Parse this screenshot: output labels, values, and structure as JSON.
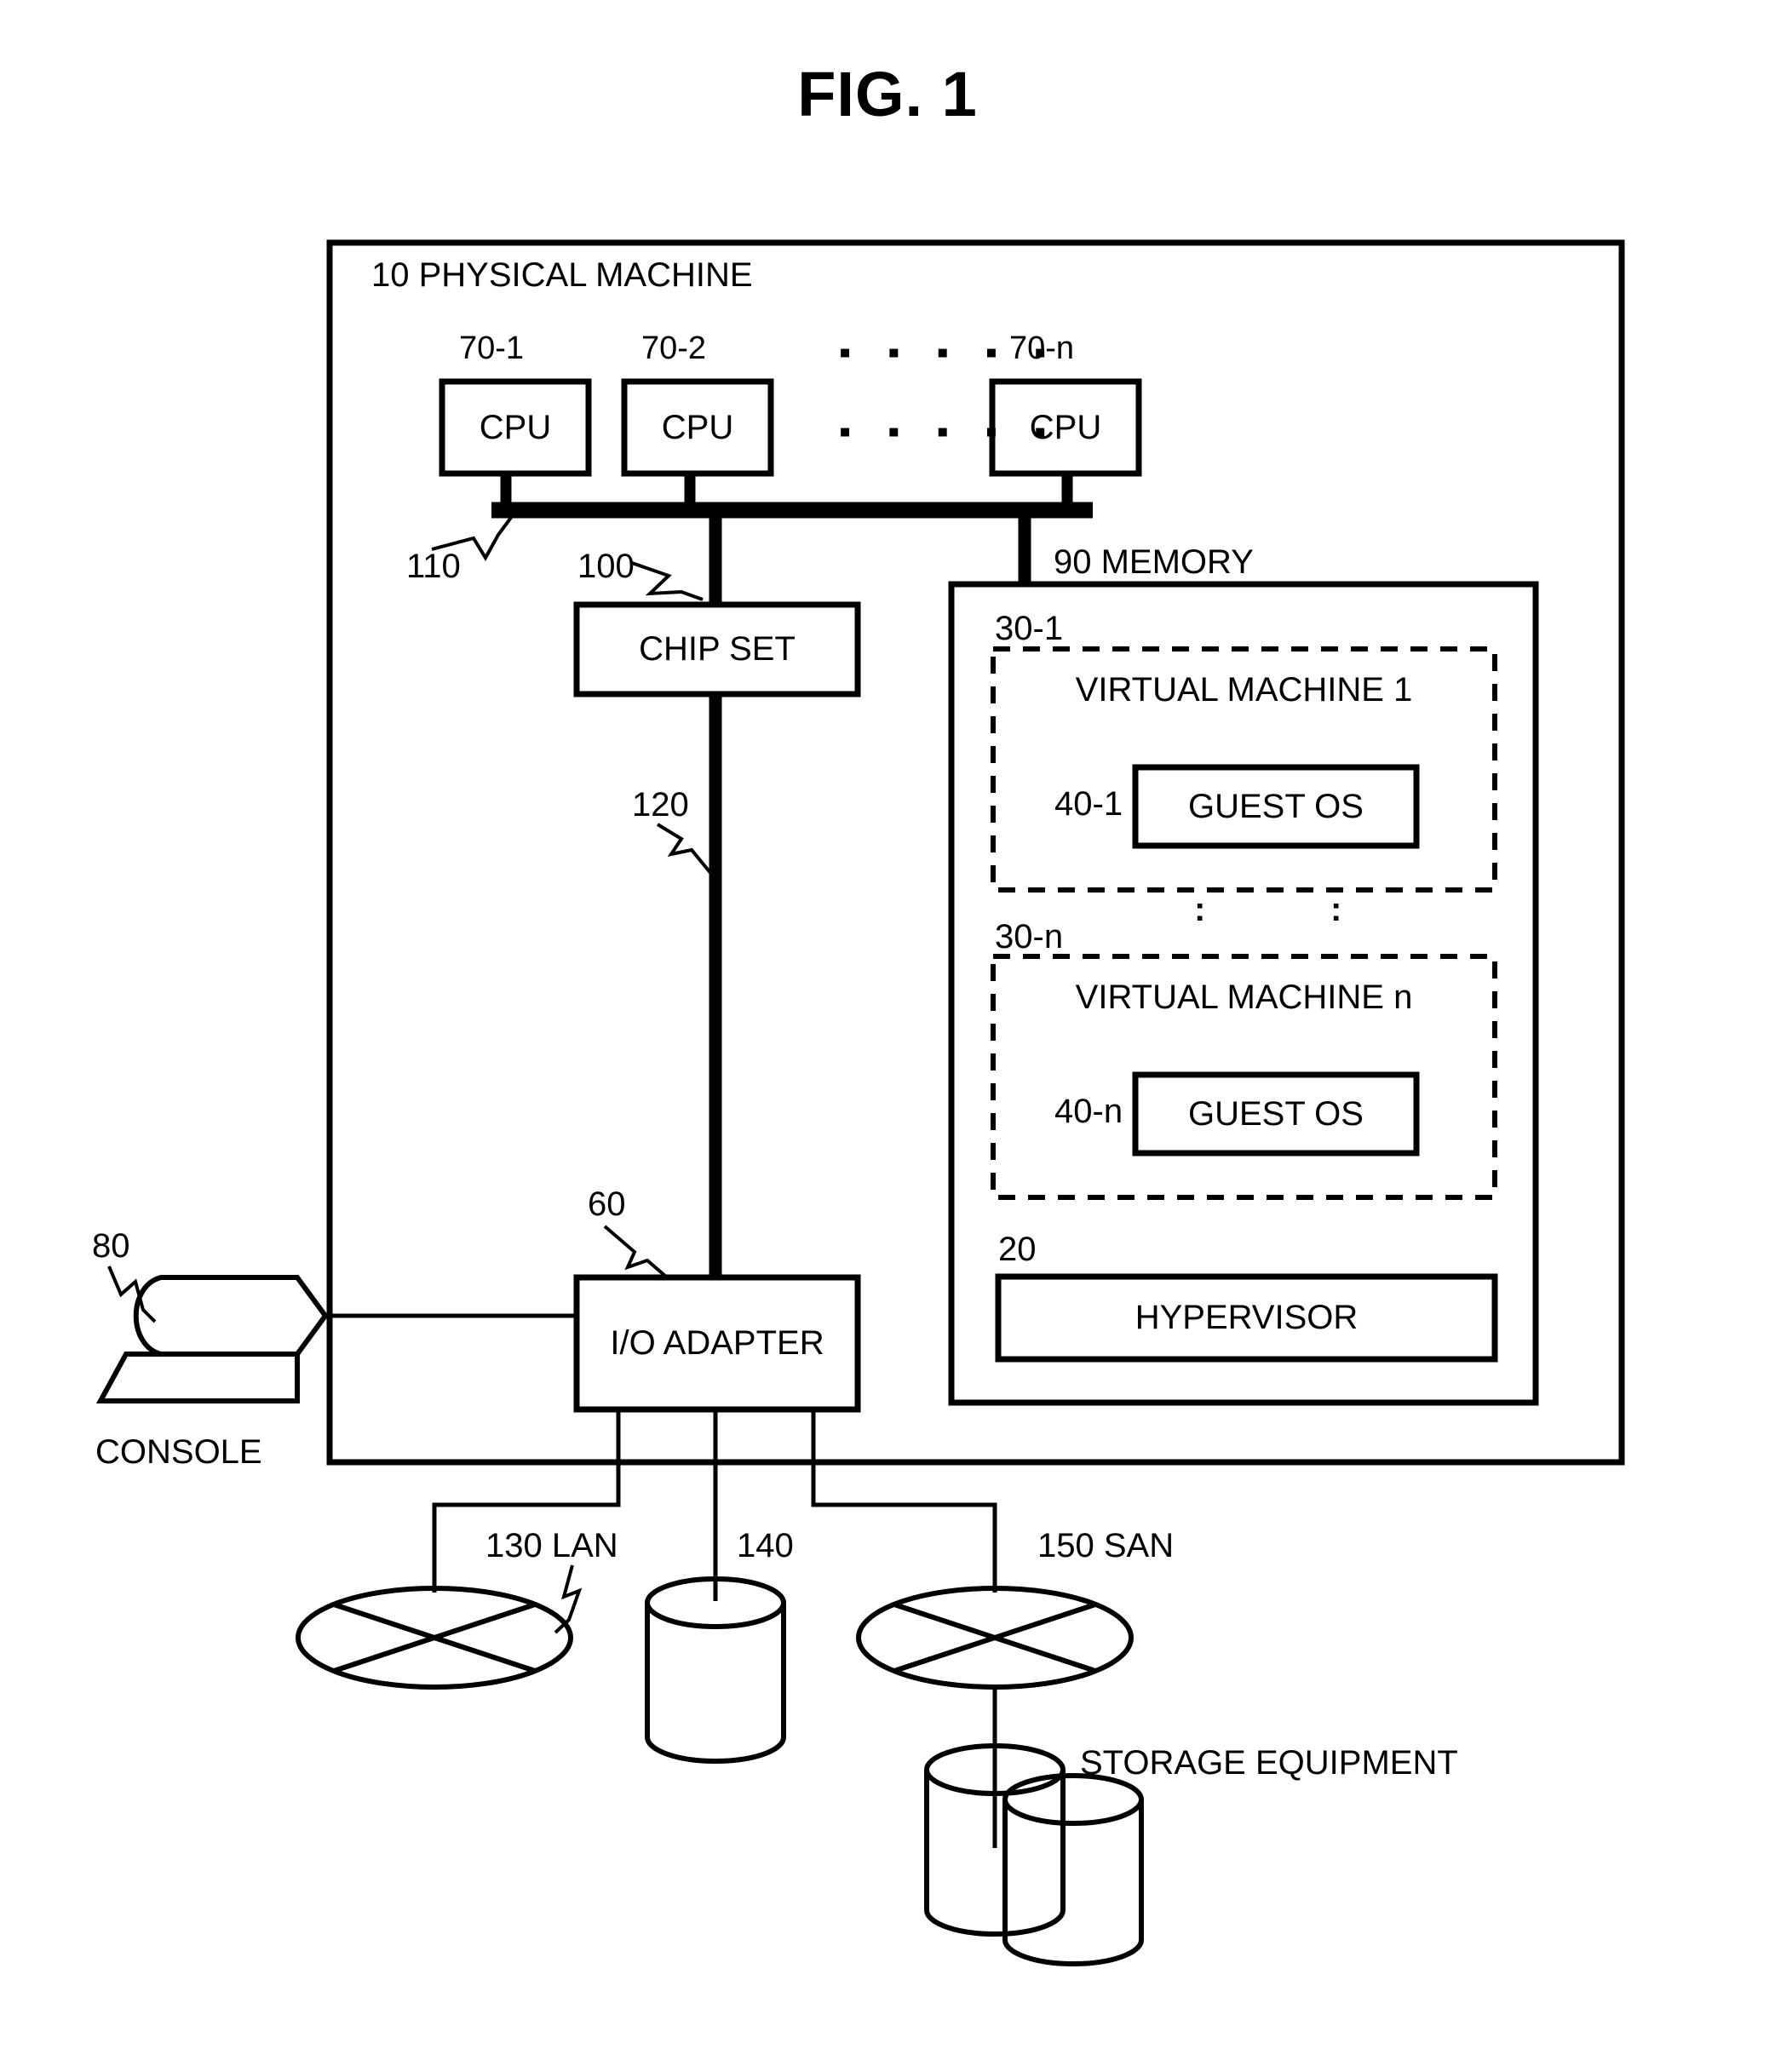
{
  "figure": {
    "title": "FIG. 1"
  },
  "physical_machine": {
    "ref": "10",
    "label": "10 PHYSICAL MACHINE"
  },
  "cpus": [
    {
      "ref": "70-1",
      "label": "CPU"
    },
    {
      "ref": "70-2",
      "label": "CPU"
    },
    {
      "ref": "70-n",
      "label": "CPU"
    }
  ],
  "cpu_ellipsis": "▪ ▪ ▪ ▪ ▪",
  "bus": {
    "ref_cpu_bus": "110",
    "ref_chipset": "100",
    "ref_io_bus": "120"
  },
  "chipset": {
    "label": "CHIP SET"
  },
  "memory": {
    "ref": "90",
    "label": "90 MEMORY",
    "virtual_machines": [
      {
        "ref": "30-1",
        "label": "VIRTUAL MACHINE 1",
        "guest_os_ref": "40-1",
        "guest_os_label": "GUEST OS"
      },
      {
        "ref": "30-n",
        "label": "VIRTUAL MACHINE n",
        "guest_os_ref": "40-n",
        "guest_os_label": "GUEST OS"
      }
    ],
    "vm_ellipsis_left": ":",
    "vm_ellipsis_right": ":",
    "hypervisor": {
      "ref": "20",
      "label": "HYPERVISOR"
    }
  },
  "io_adapter": {
    "ref": "60",
    "label": "I/O ADAPTER"
  },
  "console": {
    "ref": "80",
    "label": "CONSOLE"
  },
  "peripherals": [
    {
      "ref": "130",
      "label": "130 LAN",
      "icon": "network-cloud-icon"
    },
    {
      "ref": "140",
      "label": "140",
      "icon": "disk-cylinder-icon"
    },
    {
      "ref": "150",
      "label": "150 SAN",
      "icon": "network-cloud-icon"
    }
  ],
  "storage_equipment": {
    "label": "STORAGE EQUIPMENT",
    "icon": "storage-cylinders-icon"
  },
  "colors": {
    "line": "#000000",
    "background": "#ffffff"
  }
}
